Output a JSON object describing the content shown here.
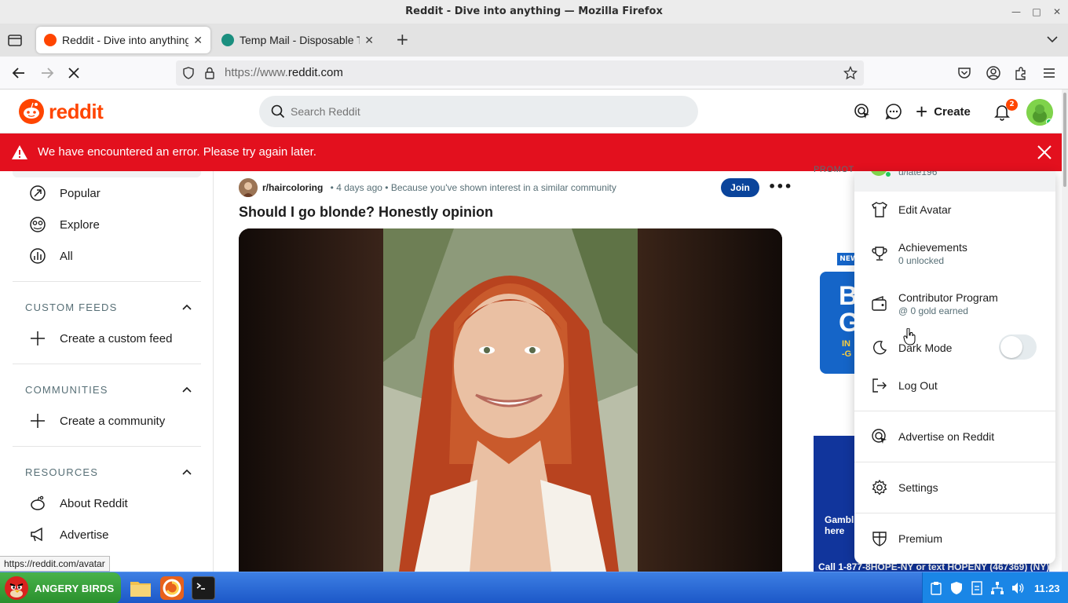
{
  "window": {
    "title": "Reddit - Dive into anything — Mozilla Firefox",
    "controls": [
      "minimize",
      "maximize",
      "close"
    ]
  },
  "tabs": [
    {
      "label": "Reddit - Dive into anything",
      "active": true,
      "favicon": "reddit-icon"
    },
    {
      "label": "Temp Mail - Disposable Tem",
      "active": false,
      "favicon": "tempmail-icon"
    }
  ],
  "navbar": {
    "url_dim": "https://www.",
    "url_main": "reddit.com"
  },
  "reddit": {
    "logo_text": "reddit",
    "search_placeholder": "Search Reddit",
    "create_label": "Create",
    "notification_count": "2",
    "brand_color": "#ff4500"
  },
  "error_banner": {
    "message": "We have encountered an error. Please try again later.",
    "color": "#e3101e"
  },
  "sidebar": {
    "nav_items": [
      {
        "label": "Popular",
        "icon": "popular-icon"
      },
      {
        "label": "Explore",
        "icon": "explore-icon"
      },
      {
        "label": "All",
        "icon": "all-icon"
      }
    ],
    "sections": {
      "custom_feeds": {
        "title": "CUSTOM FEEDS",
        "action": "Create a custom feed"
      },
      "communities": {
        "title": "COMMUNITIES",
        "action": "Create a community"
      },
      "resources": {
        "title": "RESOURCES",
        "items": [
          "About Reddit",
          "Advertise"
        ]
      }
    }
  },
  "post": {
    "subreddit": "r/haircoloring",
    "time": "4 days ago",
    "reason": "Because you've shown interest in a similar community",
    "join_label": "Join",
    "title": "Should I go blonde? Honestly opinion"
  },
  "right_column": {
    "promoted_label": "PROMOT",
    "ad1": {
      "badge": "NEW",
      "big_text": "B\nGE",
      "small_text": "IN\n-G"
    },
    "ad2": {
      "line1": "Gambl\nhere",
      "line2": "Call 1-877-8HOPE-NY or text HOPENY (467369) (NY)."
    }
  },
  "user_menu": {
    "username": "u/late196",
    "items": [
      {
        "label": "Edit Avatar",
        "icon": "shirt-icon"
      },
      {
        "label": "Achievements",
        "sub": "0 unlocked",
        "icon": "trophy-icon"
      },
      {
        "label": "Contributor Program",
        "sub": "@ 0 gold earned",
        "icon": "wallet-icon"
      },
      {
        "label": "Dark Mode",
        "icon": "moon-icon",
        "toggle_on": false
      },
      {
        "label": "Log Out",
        "icon": "logout-icon"
      },
      {
        "label": "Advertise on Reddit",
        "icon": "advertise-icon"
      },
      {
        "label": "Settings",
        "icon": "gear-icon"
      },
      {
        "label": "Premium",
        "icon": "premium-shield-icon"
      }
    ]
  },
  "status_link": "https://reddit.com/avatar",
  "taskbar": {
    "start_label": "ANGERY BIRDS",
    "apps": [
      "file-manager-icon",
      "firefox-icon",
      "terminal-icon"
    ],
    "clock": "11:23"
  }
}
